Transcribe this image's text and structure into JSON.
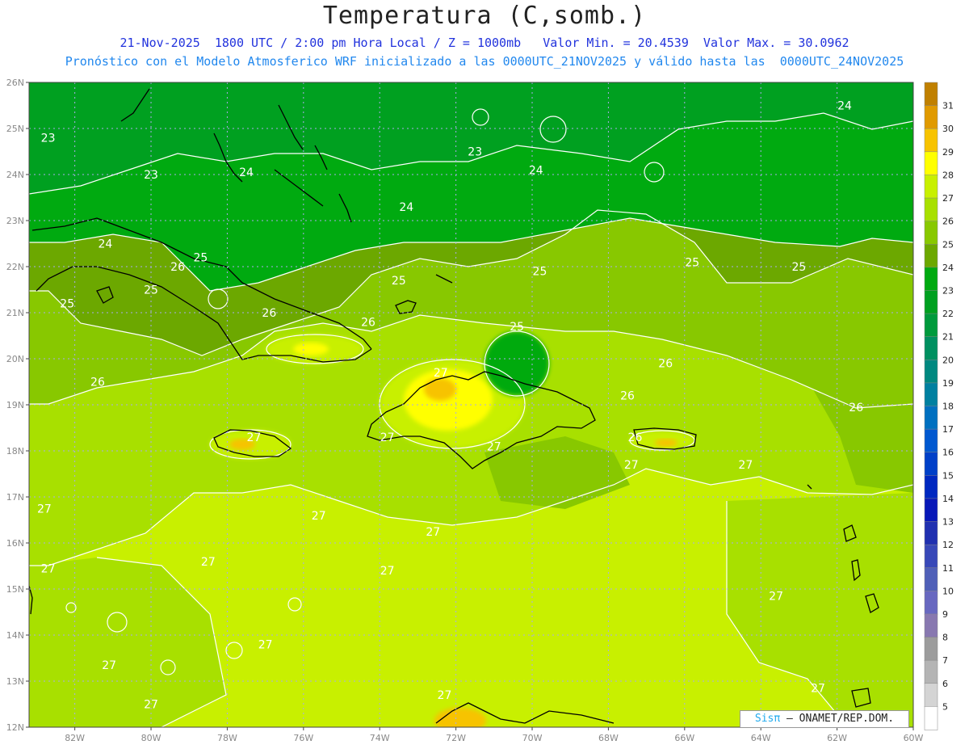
{
  "title": "Temperatura (C,somb.)",
  "subtitle_line1": "21-Nov-2025  1800 UTC / 2:00 pm Hora Local / Z = 1000mb   Valor Min. = 20.4539  Valor Max. = 30.0962",
  "subtitle_line2": "Pronóstico con el Modelo Atmosferico WRF inicializado a las 0000UTC_21NOV2025 y válido hasta las  0000UTC_24NOV2025",
  "credit": {
    "brand": "Sisπ",
    "text": " – ONAMET/REP.DOM."
  },
  "map": {
    "lat_labels": [
      "26N",
      "25N",
      "24N",
      "23N",
      "22N",
      "21N",
      "20N",
      "19N",
      "18N",
      "17N",
      "16N",
      "15N",
      "14N",
      "13N",
      "12N"
    ],
    "lon_labels": [
      "82W",
      "80W",
      "78W",
      "76W",
      "74W",
      "72W",
      "70W",
      "68W",
      "66W",
      "64W",
      "62W",
      "60W"
    ],
    "lat_range": [
      12,
      26
    ],
    "lon_range": [
      -83.2,
      -60
    ],
    "grid": "dotted",
    "contour_labels": [
      {
        "text": "23",
        "lon": -82.7,
        "lat": 24.8
      },
      {
        "text": "23",
        "lon": -80.0,
        "lat": 24.0
      },
      {
        "text": "24",
        "lon": -77.5,
        "lat": 24.05
      },
      {
        "text": "24",
        "lon": -73.3,
        "lat": 23.3
      },
      {
        "text": "23",
        "lon": -71.5,
        "lat": 24.5
      },
      {
        "text": "24",
        "lon": -69.9,
        "lat": 24.1
      },
      {
        "text": "24",
        "lon": -61.8,
        "lat": 25.5
      },
      {
        "text": "24",
        "lon": -81.2,
        "lat": 22.5
      },
      {
        "text": "25",
        "lon": -78.7,
        "lat": 22.2
      },
      {
        "text": "26",
        "lon": -79.3,
        "lat": 22.0
      },
      {
        "text": "25",
        "lon": -80.0,
        "lat": 21.5
      },
      {
        "text": "25",
        "lon": -82.2,
        "lat": 21.2
      },
      {
        "text": "26",
        "lon": -76.9,
        "lat": 21.0
      },
      {
        "text": "25",
        "lon": -73.5,
        "lat": 21.7
      },
      {
        "text": "25",
        "lon": -69.8,
        "lat": 21.9
      },
      {
        "text": "25",
        "lon": -65.8,
        "lat": 22.1
      },
      {
        "text": "25",
        "lon": -63.0,
        "lat": 22.0
      },
      {
        "text": "26",
        "lon": -74.3,
        "lat": 20.8
      },
      {
        "text": "25",
        "lon": -70.4,
        "lat": 20.7
      },
      {
        "text": "26",
        "lon": -66.5,
        "lat": 19.9
      },
      {
        "text": "26",
        "lon": -81.4,
        "lat": 19.5
      },
      {
        "text": "27",
        "lon": -72.4,
        "lat": 19.7
      },
      {
        "text": "26",
        "lon": -67.5,
        "lat": 19.2
      },
      {
        "text": "26",
        "lon": -61.5,
        "lat": 18.95
      },
      {
        "text": "27",
        "lon": -77.3,
        "lat": 18.3
      },
      {
        "text": "27",
        "lon": -73.8,
        "lat": 18.3
      },
      {
        "text": "27",
        "lon": -71.0,
        "lat": 18.1
      },
      {
        "text": "26",
        "lon": -67.3,
        "lat": 18.3
      },
      {
        "text": "27",
        "lon": -67.4,
        "lat": 17.7
      },
      {
        "text": "27",
        "lon": -64.4,
        "lat": 17.7
      },
      {
        "text": "27",
        "lon": -82.8,
        "lat": 16.75
      },
      {
        "text": "27",
        "lon": -75.6,
        "lat": 16.6
      },
      {
        "text": "27",
        "lon": -72.6,
        "lat": 16.25
      },
      {
        "text": "27",
        "lon": -82.7,
        "lat": 15.45
      },
      {
        "text": "27",
        "lon": -78.5,
        "lat": 15.6
      },
      {
        "text": "27",
        "lon": -73.8,
        "lat": 15.4
      },
      {
        "text": "27",
        "lon": -63.6,
        "lat": 14.85
      },
      {
        "text": "27",
        "lon": -77.0,
        "lat": 13.8
      },
      {
        "text": "27",
        "lon": -81.1,
        "lat": 13.35
      },
      {
        "text": "27",
        "lon": -62.5,
        "lat": 12.85
      },
      {
        "text": "27",
        "lon": -80.0,
        "lat": 12.5
      },
      {
        "text": "27",
        "lon": -72.3,
        "lat": 12.7
      }
    ]
  },
  "colorbar": {
    "ticks": [
      "31",
      "30",
      "29",
      "28",
      "27",
      "26",
      "25",
      "24",
      "23",
      "22",
      "21",
      "20",
      "19",
      "18",
      "17",
      "16",
      "15",
      "14",
      "13",
      "12",
      "11",
      "10",
      "9",
      "8",
      "7",
      "6",
      "5"
    ],
    "colors": [
      "#c08000",
      "#e09a00",
      "#f7c300",
      "#ffff00",
      "#c8f000",
      "#a8e000",
      "#88c800",
      "#6ca800",
      "#00aa10",
      "#00a020",
      "#009a3c",
      "#009060",
      "#008880",
      "#0080a0",
      "#0070c0",
      "#0058d0",
      "#0040c8",
      "#0028c0",
      "#0818b8",
      "#2030b0",
      "#3848b8",
      "#5060b8",
      "#6868c0",
      "#8878b0",
      "#9c9c9c",
      "#b4b4b4",
      "#d4d4d4",
      "#ffffff"
    ]
  },
  "colors": {
    "land_outline": "#000000",
    "contour": "#ffffff",
    "grid": "#aaaaee"
  }
}
